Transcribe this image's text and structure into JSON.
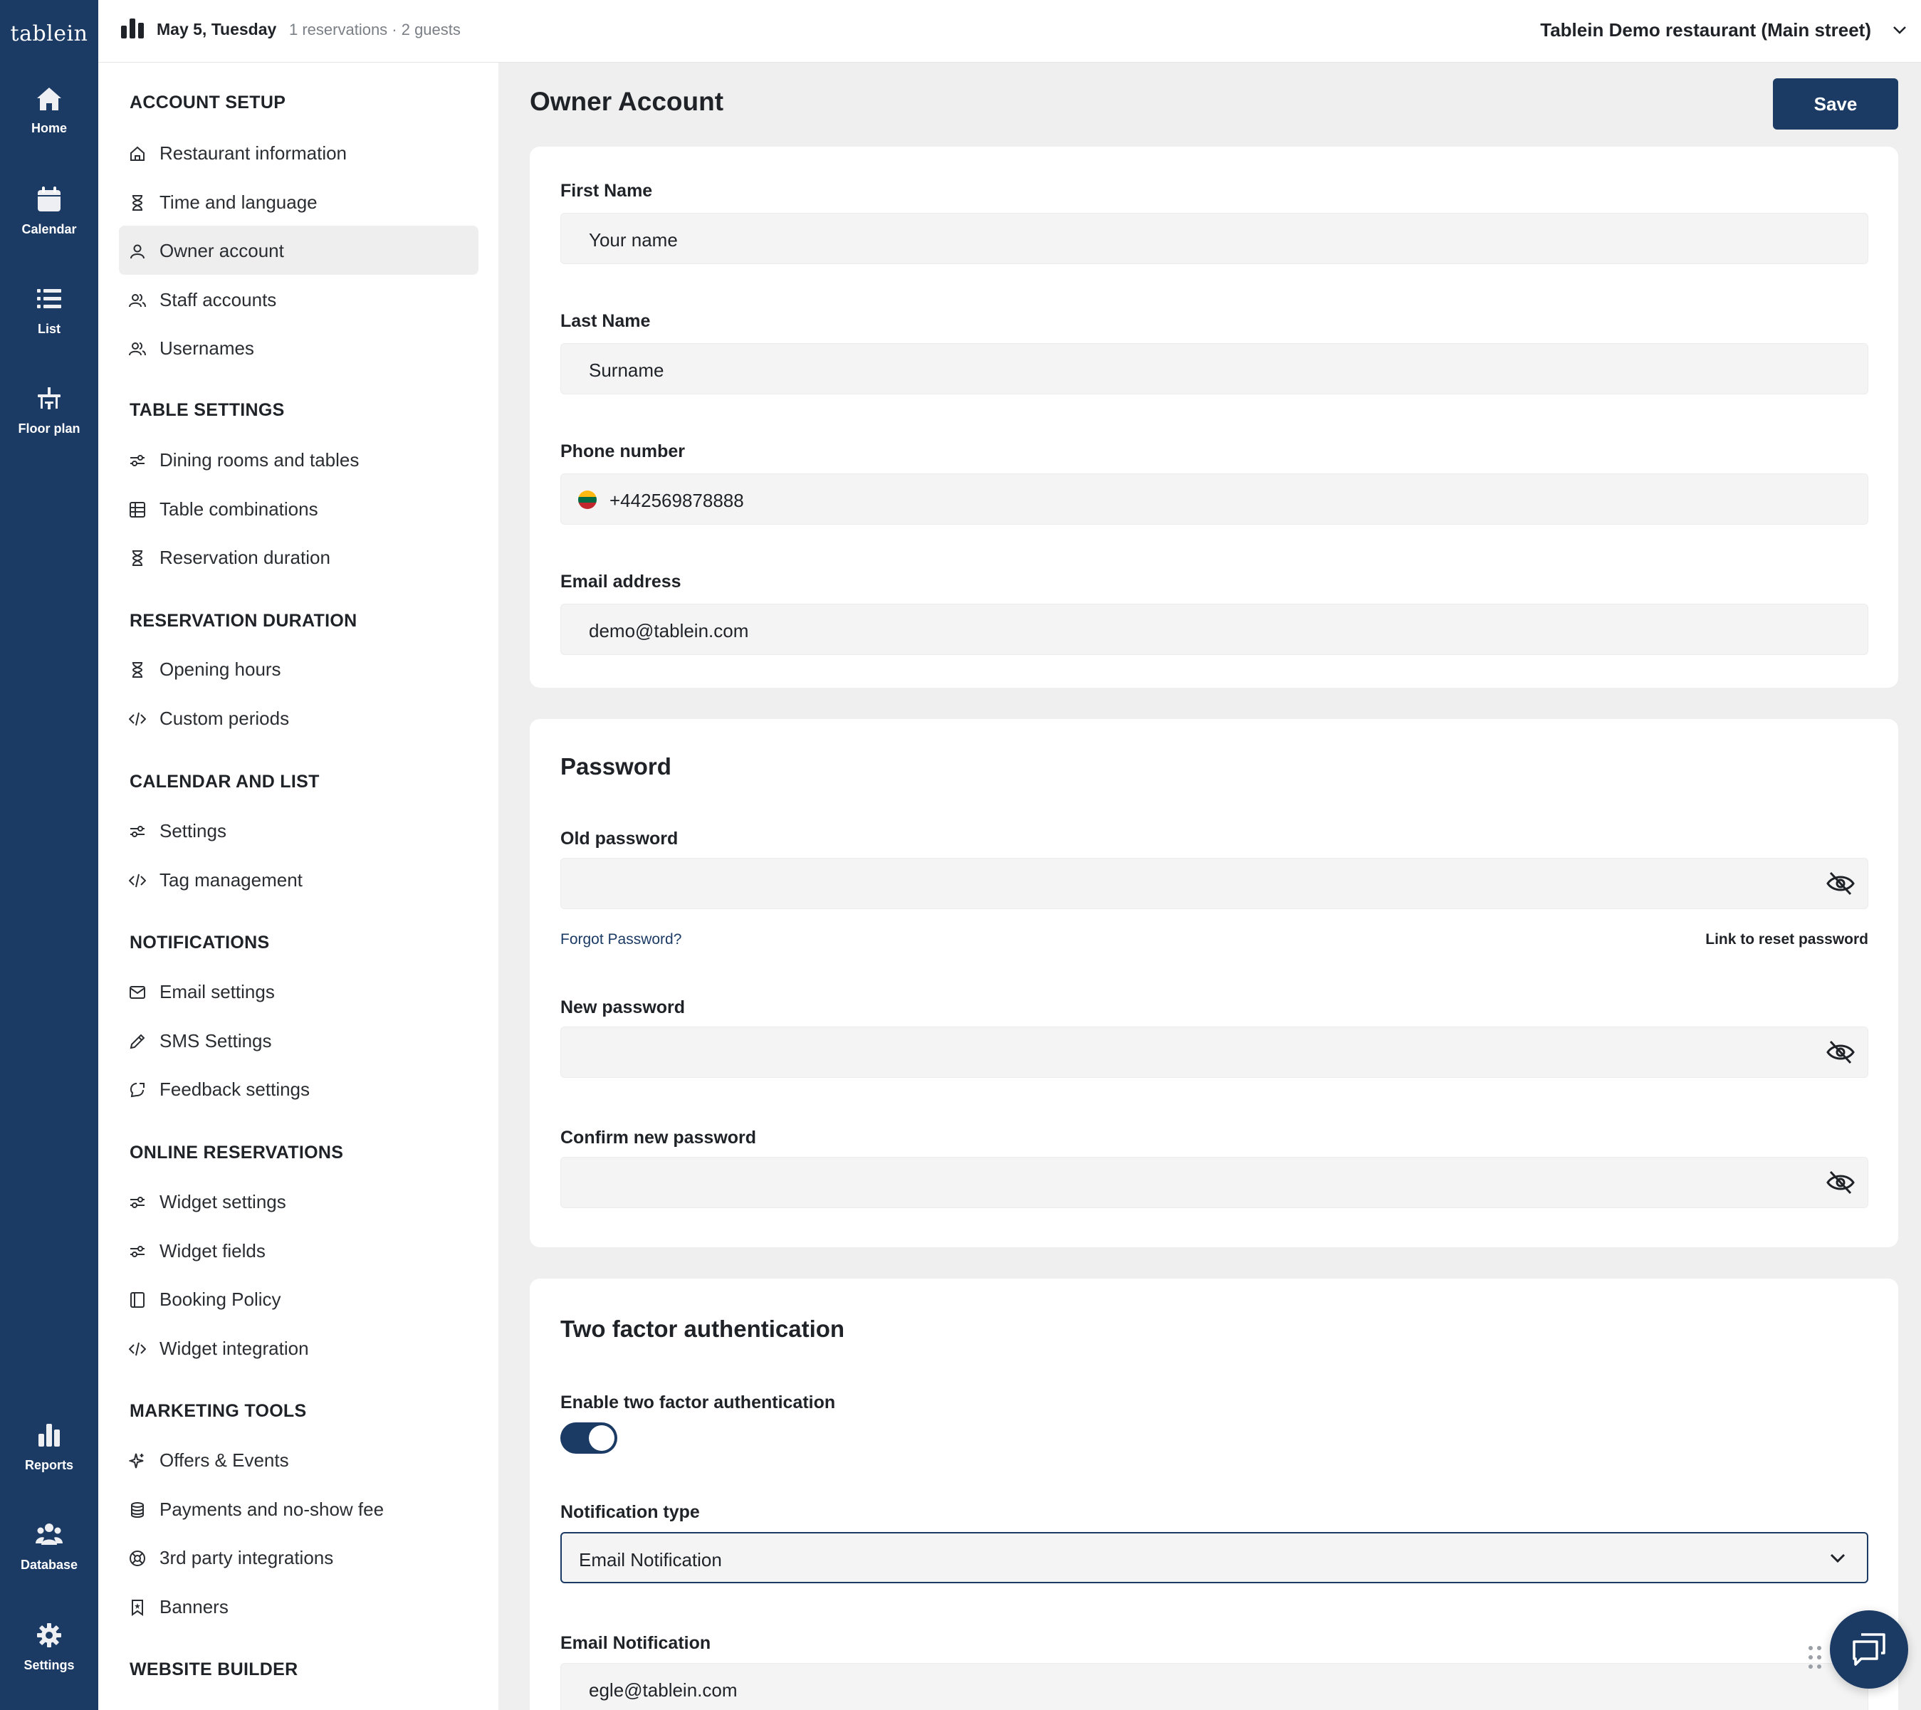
{
  "app": {
    "logo": "tablein"
  },
  "rail": {
    "top": [
      {
        "label": "Home",
        "icon": "home-icon"
      },
      {
        "label": "Calendar",
        "icon": "calendar-icon"
      },
      {
        "label": "List",
        "icon": "list-icon"
      },
      {
        "label": "Floor plan",
        "icon": "floor-plan-icon"
      }
    ],
    "bottom": [
      {
        "label": "Reports",
        "icon": "reports-icon"
      },
      {
        "label": "Database",
        "icon": "database-icon"
      },
      {
        "label": "Settings",
        "icon": "gear-icon"
      }
    ]
  },
  "topbar": {
    "date": "May 5, Tuesday",
    "meta": "1 reservations · 2 guests",
    "restaurant": "Tablein Demo restaurant (Main street)"
  },
  "nav": {
    "sections": [
      {
        "title": "ACCOUNT SETUP",
        "items": [
          {
            "label": "Restaurant information",
            "icon": "house-icon"
          },
          {
            "label": "Time and language",
            "icon": "hourglass-icon"
          },
          {
            "label": "Owner account",
            "icon": "user-icon",
            "active": true
          },
          {
            "label": "Staff accounts",
            "icon": "users-icon"
          },
          {
            "label": "Usernames",
            "icon": "users-icon"
          }
        ]
      },
      {
        "title": "TABLE SETTINGS",
        "items": [
          {
            "label": "Dining rooms and tables",
            "icon": "sliders-icon"
          },
          {
            "label": "Table combinations",
            "icon": "table-grid-icon"
          },
          {
            "label": "Reservation duration",
            "icon": "hourglass-icon"
          }
        ]
      },
      {
        "title": "RESERVATION DURATION",
        "items": [
          {
            "label": "Opening hours",
            "icon": "hourglass-icon"
          },
          {
            "label": "Custom periods",
            "icon": "code-icon"
          }
        ]
      },
      {
        "title": "CALENDAR AND LIST",
        "items": [
          {
            "label": "Settings",
            "icon": "sliders-icon"
          },
          {
            "label": "Tag management",
            "icon": "code-icon"
          }
        ]
      },
      {
        "title": "NOTIFICATIONS",
        "items": [
          {
            "label": "Email settings",
            "icon": "envelope-icon"
          },
          {
            "label": "SMS Settings",
            "icon": "pencil-icon"
          },
          {
            "label": "Feedback settings",
            "icon": "feedback-icon"
          }
        ]
      },
      {
        "title": "ONLINE RESERVATIONS",
        "items": [
          {
            "label": "Widget settings",
            "icon": "sliders-icon"
          },
          {
            "label": "Widget fields",
            "icon": "sliders-icon"
          },
          {
            "label": "Booking Policy",
            "icon": "book-icon"
          },
          {
            "label": "Widget integration",
            "icon": "code-icon"
          }
        ]
      },
      {
        "title": "MARKETING TOOLS",
        "items": [
          {
            "label": "Offers & Events",
            "icon": "sparkle-icon"
          },
          {
            "label": "Payments and no-show fee",
            "icon": "coins-icon"
          },
          {
            "label": "3rd party integrations",
            "icon": "lifebuoy-icon"
          },
          {
            "label": "Banners",
            "icon": "bookmark-icon"
          }
        ]
      },
      {
        "title": "WEBSITE BUILDER",
        "items": []
      }
    ]
  },
  "page": {
    "title": "Owner Account",
    "save_label": "Save"
  },
  "profile": {
    "first_name_label": "First Name",
    "first_name_value": "Your name",
    "last_name_label": "Last Name",
    "last_name_value": "Surname",
    "phone_label": "Phone number",
    "phone_value": "+442569878888",
    "email_label": "Email address",
    "email_value": "demo@tablein.com"
  },
  "password": {
    "title": "Password",
    "old_label": "Old password",
    "forgot": "Forgot Password?",
    "reset_hint": "Link to reset password",
    "new_label": "New password",
    "confirm_label": "Confirm new password"
  },
  "twofa": {
    "title": "Two factor authentication",
    "enable_label": "Enable two factor authentication",
    "enabled": true,
    "type_label": "Notification type",
    "type_value": "Email Notification",
    "email_label": "Email Notification",
    "email_value": "egle@tablein.com"
  },
  "colors": {
    "brand": "#1b3a64",
    "panel": "#ffffff",
    "background": "#efefef"
  }
}
